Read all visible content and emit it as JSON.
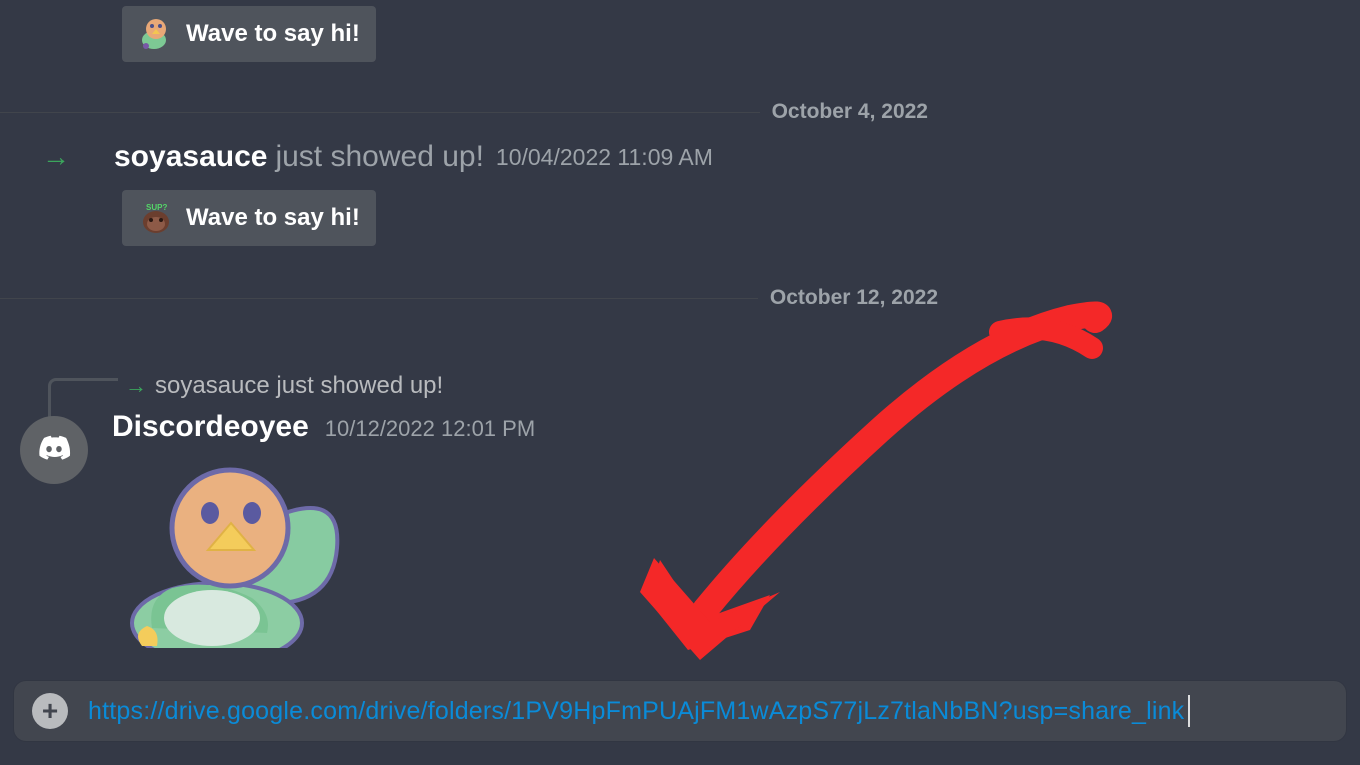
{
  "wave_button_1": {
    "label": "Wave to say hi!"
  },
  "date_divider_1": {
    "text": "October 4, 2022"
  },
  "join_event": {
    "username": "soyasauce",
    "action": "just showed up!",
    "timestamp": "10/04/2022 11:09 AM"
  },
  "wave_button_2": {
    "label": "Wave to say hi!"
  },
  "date_divider_2": {
    "text": "October 12, 2022"
  },
  "reply": {
    "username": "soyasauce",
    "text": "just showed up!"
  },
  "message": {
    "username": "Discordeoyee",
    "timestamp": "10/12/2022 12:01 PM"
  },
  "input": {
    "value": "https://drive.google.com/drive/folders/1PV9HpFmPUAjFM1wAzpS77jLz7tlaNbBN?usp=share_link"
  }
}
